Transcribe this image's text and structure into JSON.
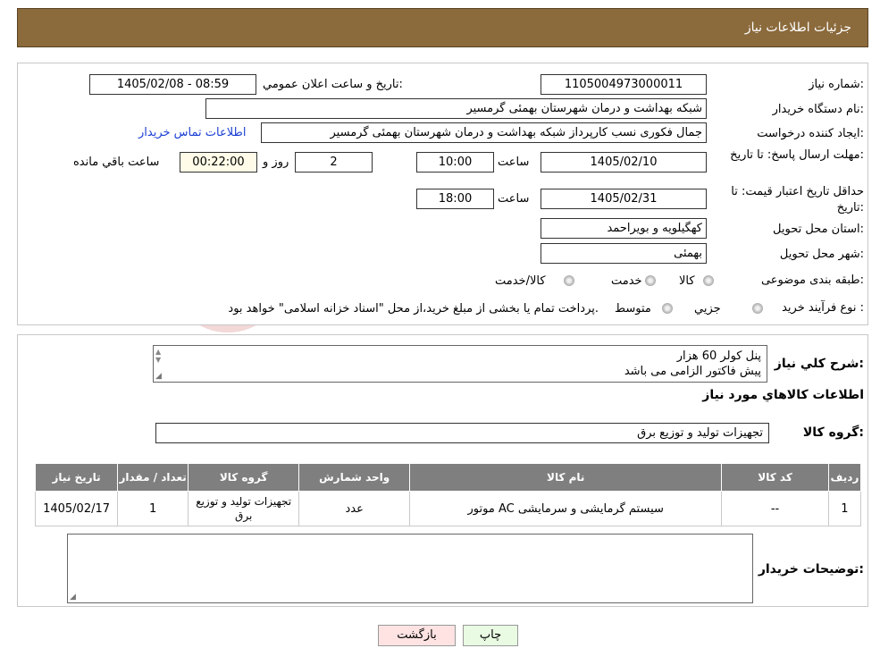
{
  "header": {
    "title": "جزئیات اطلاعات نیاز"
  },
  "form": {
    "need_number_label": "شماره نیاز:",
    "need_number": "1105004973000011",
    "announce_label": "تاریخ و ساعت اعلان عمومي:",
    "announce_value": "1405/02/08 - 08:59",
    "buyer_org_label": "نام دستگاه خريدار:",
    "buyer_org": "شبکه بهداشت و درمان شهرستان بهمئی گرمسیر",
    "creator_label": "ايجاد کننده درخواست:",
    "creator": "جمال  فکوری نسب کارپرداز شبکه بهداشت و درمان شهرستان بهمئی گرمسیر",
    "contact_link": "اطلاعات تماس خريدار",
    "reply_deadline_label": "مهلت ارسال پاسخ: تا تاریخ:",
    "reply_date": "1405/02/10",
    "time_label": "ساعت",
    "reply_time": "10:00",
    "days_value": "2",
    "days_label": "روز و",
    "remaining_time": "00:22:00",
    "remaining_label": "ساعت باقي مانده",
    "price_valid_label": "حداقل تاريخ اعتبار قيمت: تا تاریخ:",
    "price_valid_date": "1405/02/31",
    "price_valid_time": "18:00",
    "province_label": "استان محل تحويل:",
    "province": "کهگیلویه و بویراحمد",
    "city_label": "شهر محل تحويل:",
    "city": "بهمئی",
    "category_label": "طبقه بندی موضوعی:",
    "category_options": [
      "کالا",
      "خدمت",
      "کالا/خدمت"
    ],
    "process_label": "نوع فرآيند خريد :",
    "process_options": [
      "جزيي",
      "متوسط"
    ],
    "process_note": "پرداخت تمام يا بخشی از مبلغ خريد،از محل \"اسناد خزانه اسلامی\" خواهد بود."
  },
  "description": {
    "label": "شرح کلي نياز:",
    "line1": "پنل کولر 60 هزار",
    "line2": "پیش فاکتور الزامی می باشد"
  },
  "goods": {
    "section_title": "اطلاعات کالاهاي مورد نياز",
    "group_label": "گروه کالا:",
    "group_value": "تجهیزات تولید و توزیع برق",
    "columns": [
      "رديف",
      "کد کالا",
      "نام کالا",
      "واحد شمارش",
      "گروه کالا",
      "تعداد / مقدار",
      "تاريخ نياز"
    ],
    "rows": [
      {
        "row": "1",
        "code": "--",
        "name": "موتور AC سیستم گرمایشی و سرمایشی",
        "unit": "عدد",
        "group": "تجهیزات تولید و توزیع برق",
        "qty": "1",
        "date": "1405/02/17"
      }
    ]
  },
  "buyer_notes": {
    "label": "توضيحات خريدار:",
    "value": ""
  },
  "buttons": {
    "print": "چاپ",
    "back": "بازگشت"
  },
  "colors": {
    "header": "#8b6a3c",
    "table_header": "#7f7f7f",
    "print_btn": "#e9fbe3",
    "back_btn": "#ffe3e3"
  }
}
